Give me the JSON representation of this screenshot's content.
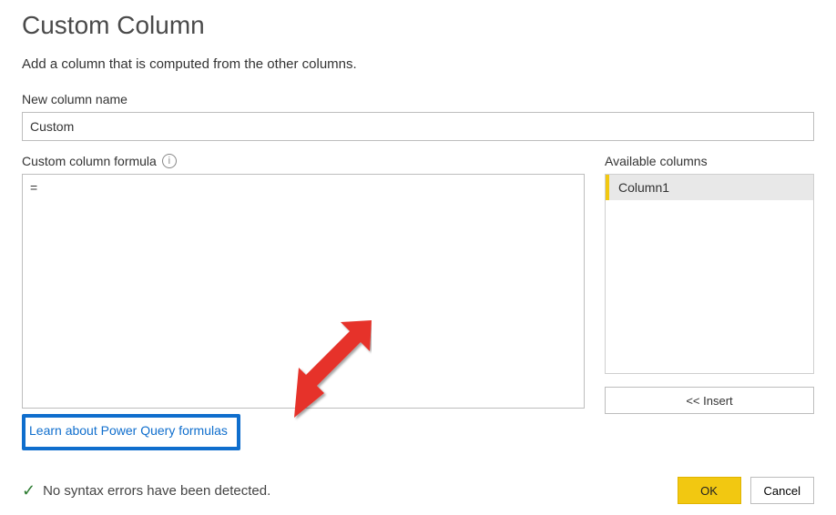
{
  "dialog": {
    "title": "Custom Column",
    "subtitle": "Add a column that is computed from the other columns."
  },
  "newColumn": {
    "label": "New column name",
    "value": "Custom"
  },
  "formula": {
    "label": "Custom column formula",
    "value": "="
  },
  "availableColumns": {
    "label": "Available columns",
    "items": [
      "Column1"
    ],
    "insertLabel": "<< Insert"
  },
  "helpLink": {
    "text": "Learn about Power Query formulas"
  },
  "status": {
    "text": "No syntax errors have been detected."
  },
  "buttons": {
    "ok": "OK",
    "cancel": "Cancel"
  }
}
